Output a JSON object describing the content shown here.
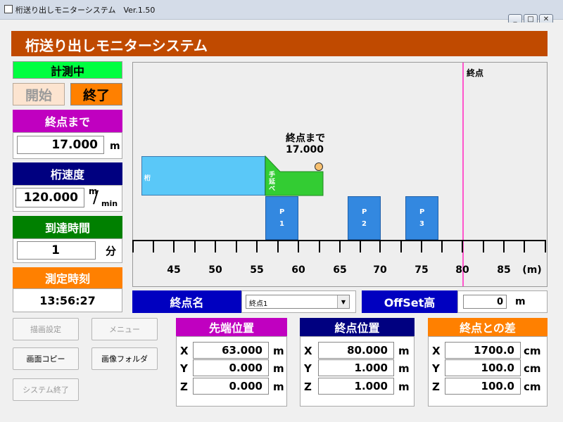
{
  "window": {
    "title": "桁送り出しモニターシステム　Ver.1.50",
    "min_icon": "minimize-icon",
    "max_icon": "maximize-icon",
    "close_icon": "close-icon"
  },
  "header": {
    "title": "桁送り出しモニターシステム",
    "color": "#c04a00"
  },
  "status": {
    "label": "計測中",
    "color": "#00ff40"
  },
  "controls": {
    "start_label": "開始",
    "end_label": "終了"
  },
  "panels": {
    "remaining": {
      "label": "終点まで",
      "value": "17.000",
      "unit": "m",
      "color": "#c000c0"
    },
    "speed": {
      "label": "桁速度",
      "value": "120.000",
      "unit_top": "m",
      "unit_slash": "/",
      "unit_bottom": "min",
      "color": "#000080"
    },
    "arrival": {
      "label": "到達時間",
      "value": "1",
      "unit": "分",
      "color": "#008000"
    },
    "measured_time": {
      "label": "測定時刻",
      "value": "13:56:27",
      "color": "#ff8000"
    }
  },
  "canvas": {
    "endpoint_label": "終点",
    "remaining_label": "終点まで",
    "remaining_value": "17.000",
    "girder_label": "桁",
    "nose_label": "手延べ",
    "piers": [
      {
        "label_top": "P",
        "label_bottom": "1"
      },
      {
        "label_top": "P",
        "label_bottom": "2"
      },
      {
        "label_top": "P",
        "label_bottom": "3"
      }
    ],
    "axis_ticks": [
      "45",
      "50",
      "55",
      "60",
      "65",
      "70",
      "75",
      "80",
      "85"
    ],
    "axis_unit": "(m)",
    "colors": {
      "girder": "#5ac8f8",
      "nose": "#33cc33",
      "pier": "#3388e0",
      "endline": "#ff55cc"
    }
  },
  "endpoint_row": {
    "label": "終点名",
    "select_value": "終点1",
    "offset_label": "OffSet高",
    "offset_value": "0",
    "offset_unit": "m"
  },
  "buttons": {
    "draw_settings": "描画設定",
    "menu": "メニュー",
    "screen_copy": "画面コピー",
    "image_folder": "画像フォルダ",
    "system_exit": "システム終了"
  },
  "tip_position": {
    "title": "先端位置",
    "rows": [
      {
        "axis": "X",
        "value": "63.000",
        "unit": "m"
      },
      {
        "axis": "Y",
        "value": "0.000",
        "unit": "m"
      },
      {
        "axis": "Z",
        "value": "0.000",
        "unit": "m"
      }
    ]
  },
  "end_position": {
    "title": "終点位置",
    "rows": [
      {
        "axis": "X",
        "value": "80.000",
        "unit": "m"
      },
      {
        "axis": "Y",
        "value": "1.000",
        "unit": "m"
      },
      {
        "axis": "Z",
        "value": "1.000",
        "unit": "m"
      }
    ]
  },
  "diff": {
    "title": "終点との差",
    "rows": [
      {
        "axis": "X",
        "value": "1700.0",
        "unit": "cm"
      },
      {
        "axis": "Y",
        "value": "100.0",
        "unit": "cm"
      },
      {
        "axis": "Z",
        "value": "100.0",
        "unit": "cm"
      }
    ]
  }
}
